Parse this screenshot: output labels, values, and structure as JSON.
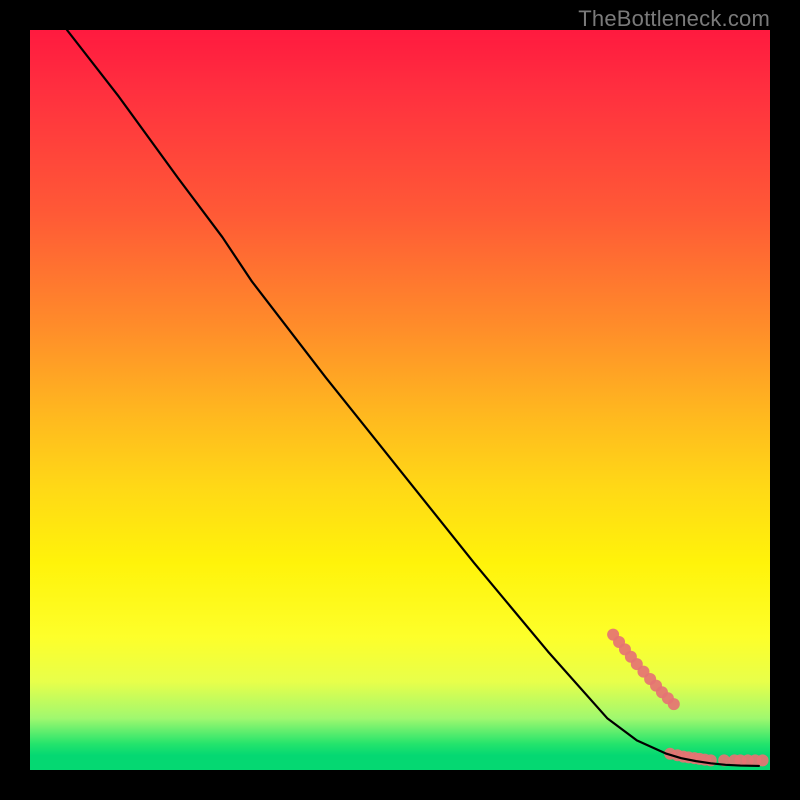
{
  "attribution": "TheBottleneck.com",
  "chart_data": {
    "type": "line",
    "title": "",
    "xlabel": "",
    "ylabel": "",
    "xlim": [
      0,
      100
    ],
    "ylim": [
      0,
      100
    ],
    "grid": false,
    "legend": false,
    "series": [
      {
        "name": "curve",
        "type": "line",
        "color": "#000000",
        "x": [
          5,
          12,
          20,
          26,
          30,
          40,
          50,
          60,
          70,
          78,
          82,
          86,
          88,
          90,
          92,
          94,
          96,
          98.5
        ],
        "y": [
          100,
          91,
          80,
          72,
          66,
          53,
          40.5,
          28,
          16,
          7,
          4,
          2.2,
          1.6,
          1.2,
          0.9,
          0.7,
          0.6,
          0.55
        ]
      },
      {
        "name": "upper-dot-cluster",
        "type": "scatter",
        "color": "#e57373",
        "radius": 6,
        "x": [
          78.8,
          79.6,
          80.4,
          81.2,
          82.0,
          82.9,
          83.8,
          84.6,
          85.4,
          86.2,
          87.0
        ],
        "y": [
          18.3,
          17.3,
          16.3,
          15.3,
          14.3,
          13.3,
          12.3,
          11.4,
          10.5,
          9.7,
          8.9
        ]
      },
      {
        "name": "lower-dot-cluster",
        "type": "scatter",
        "color": "#e57373",
        "radius": 6,
        "x": [
          86.5,
          87.5,
          88.3,
          89.0,
          89.8,
          90.5,
          91.2,
          92.0,
          93.8,
          95.2,
          96.0,
          97.0,
          98.0,
          99.0
        ],
        "y": [
          2.2,
          2.0,
          1.8,
          1.7,
          1.6,
          1.5,
          1.4,
          1.3,
          1.3,
          1.3,
          1.3,
          1.3,
          1.3,
          1.3
        ]
      }
    ]
  },
  "colors": {
    "marker": "#e57373",
    "line": "#000000",
    "attribution": "#7a7a7a"
  }
}
